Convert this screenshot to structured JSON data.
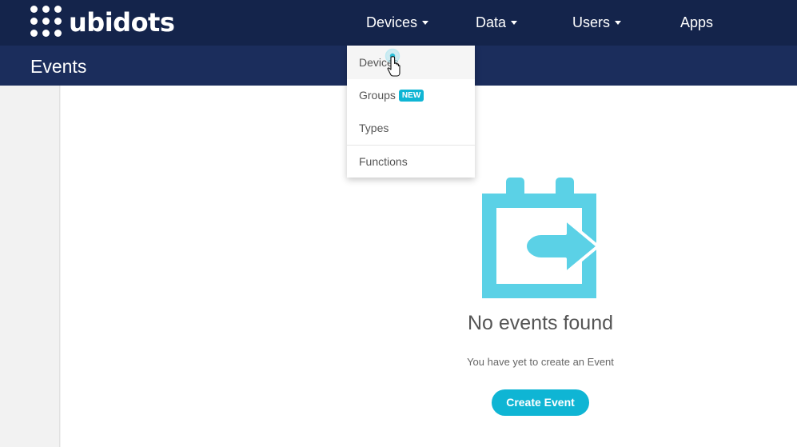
{
  "brand": {
    "name": "ubidots"
  },
  "nav": {
    "devices_label": "Devices",
    "data_label": "Data",
    "users_label": "Users",
    "apps_label": "Apps"
  },
  "page": {
    "title": "Events"
  },
  "devices_menu": {
    "items": [
      {
        "label": "Devices"
      },
      {
        "label": "Groups",
        "badge": "NEW"
      },
      {
        "label": "Types"
      },
      {
        "label": "Functions"
      }
    ]
  },
  "empty_state": {
    "title": "No events found",
    "subtitle": "You have yet to create an Event",
    "button_label": "Create Event",
    "icon": "calendar-arrow-icon"
  },
  "colors": {
    "topbar": "#14244b",
    "subbar": "#1b2d5c",
    "accent": "#0fb5d4",
    "icon": "#5bd1e6"
  }
}
